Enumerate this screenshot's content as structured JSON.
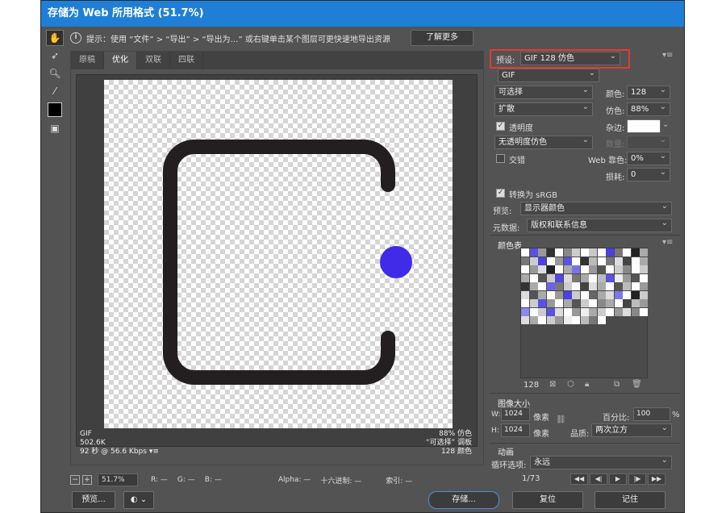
{
  "window": {
    "title": "存储为 Web 所用格式 (51.7%)"
  },
  "hint": {
    "text": "提示：使用 “文件” > “导出” > “导出为…” 或右键单击某个图层可更快速地导出资源",
    "learn_more": "了解更多"
  },
  "tabs": [
    "原稿",
    "优化",
    "双联",
    "四联"
  ],
  "active_tab": "优化",
  "canvas_info": {
    "left": [
      "GIF",
      "502.6K",
      "92 秒 @ 56.6 Kbps"
    ],
    "right": [
      "88% 仿色",
      "“可选择” 调板",
      "128 颜色"
    ]
  },
  "artwork": {
    "stroke_color": "#231f20",
    "dot_color": "#3f2be8"
  },
  "status": {
    "zoom": "51.7%",
    "r": "R: —",
    "g": "G: —",
    "b": "B: —",
    "alpha": "Alpha: —",
    "hex": "十六进制: —",
    "index": "索引: —"
  },
  "buttons": {
    "preview": "预览...",
    "save": "存储...",
    "reset": "复位",
    "remember": "记住"
  },
  "settings": {
    "preset_label": "预设:",
    "preset_value": "GIF 128 仿色",
    "format": "GIF",
    "reduction": "可选择",
    "colors_label": "颜色:",
    "colors_value": "128",
    "dither_algo": "扩散",
    "dither_label": "仿色:",
    "dither_value": "88%",
    "transparency_label": "透明度",
    "matte_label": "杂边:",
    "trans_dither": "无透明度仿色",
    "amount_label": "数量:",
    "interlaced_label": "交错",
    "web_snap_label": "Web 靠色:",
    "web_snap_value": "0%",
    "lossy_label": "损耗:",
    "lossy_value": "0",
    "convert_srgb": "转换为 sRGB",
    "preview_label": "预览:",
    "preview_value": "显示器颜色",
    "metadata_label": "元数据:",
    "metadata_value": "版权和联系信息"
  },
  "color_table": {
    "title": "颜色表",
    "count": "128"
  },
  "image_size": {
    "title": "图像大小",
    "w_label": "W:",
    "w_value": "1024",
    "h_label": "H:",
    "h_value": "1024",
    "unit": "像素",
    "percent_label": "百分比:",
    "percent_value": "100",
    "percent_unit": "%",
    "quality_label": "品质:",
    "quality_value": "两次立方"
  },
  "animation": {
    "title": "动画",
    "loop_label": "循环选项:",
    "loop_value": "永远",
    "frame": "1/73"
  },
  "palette": [
    "#fff",
    "#5b52e0",
    "#999",
    "#333",
    "#fff",
    "#888",
    "#ccc",
    "#fff",
    "#c9c9c9",
    "#fff",
    "#4a3fe0",
    "#777",
    "#fff",
    "#222",
    "#aaa",
    "#777",
    "#ccc",
    "#4c3fe6",
    "#fff",
    "#999",
    "#5b52e0",
    "#fff",
    "#333",
    "#bbb",
    "#fff",
    "#777",
    "#ddd",
    "#444",
    "#fff",
    "#aaa",
    "#fff",
    "#999",
    "#ddd",
    "#222",
    "#fff",
    "#aaa",
    "#7a72ea",
    "#fff",
    "#999",
    "#555",
    "#fff",
    "#ccc",
    "#888",
    "#fff",
    "#ccc",
    "#aaa",
    "#fff",
    "#555",
    "#ccc",
    "#5147e4",
    "#ddd",
    "#777",
    "#aaa",
    "#fff",
    "#bbb",
    "#5b52e0",
    "#eee",
    "#999",
    "#555",
    "#fff",
    "#333",
    "#aaa",
    "#fff",
    "#6b63e7",
    "#777",
    "#ccc",
    "#fff",
    "#444",
    "#ddd",
    "#aaa",
    "#fff",
    "#555",
    "#bbb",
    "#fff",
    "#999",
    "#ddd",
    "#555",
    "#aaa",
    "#fff",
    "#999",
    "#4c3fe6",
    "#ccc",
    "#fff",
    "#666",
    "#aaa",
    "#ddd",
    "#7d76ea",
    "#fff",
    "#222",
    "#ccc",
    "#fff",
    "#ccc",
    "#5a50e6",
    "#999",
    "#fff",
    "#aaa",
    "#555",
    "#ccc",
    "#fff",
    "#888",
    "#aaa",
    "#fff",
    "#444",
    "#bbb",
    "#999",
    "#8f88ee",
    "#fff",
    "#ccc",
    "#5b52e0",
    "#ddd",
    "#fff",
    "#999",
    "#eee",
    "#aaa",
    "#ccc",
    "#fff",
    "#999",
    "#ddd",
    "#888",
    "#fff",
    "#ddd",
    "#aaa",
    "#fff",
    "#ccc",
    "#999",
    "#eee",
    "#fff",
    "#bbb",
    "#777",
    "#fff"
  ]
}
